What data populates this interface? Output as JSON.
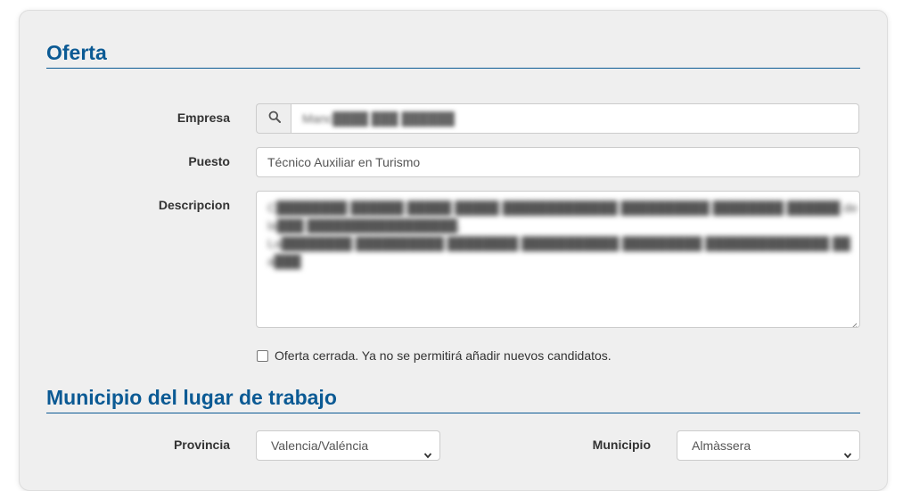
{
  "oferta": {
    "section_title": "Oferta",
    "empresa": {
      "label": "Empresa",
      "value": "Manc████ ███ ██████",
      "search_icon": "search-icon"
    },
    "puesto": {
      "label": "Puesto",
      "value": "Técnico Auxiliar en Turismo"
    },
    "descripcion": {
      "label": "Descripcion",
      "lines": [
        "C████████ ██████ █████ █████ █████████████ ██████████ ████████ ██████ de",
        "la███ █████████████████.",
        "La████████ ██████████ ████████ ███████████ █████████ ██████████████ ██",
        "a███"
      ]
    },
    "cerrada": {
      "label": "Oferta cerrada. Ya no se permitirá añadir nuevos candidatos.",
      "checked": false
    }
  },
  "municipio_section": {
    "section_title": "Municipio del lugar de trabajo",
    "provincia": {
      "label": "Provincia",
      "selected": "Valencia/Valéncia"
    },
    "municipio": {
      "label": "Municipio",
      "selected": "Almàssera"
    }
  },
  "colors": {
    "accent": "#0b5a94",
    "panel_bg": "#efefef",
    "border": "#cccccc"
  }
}
